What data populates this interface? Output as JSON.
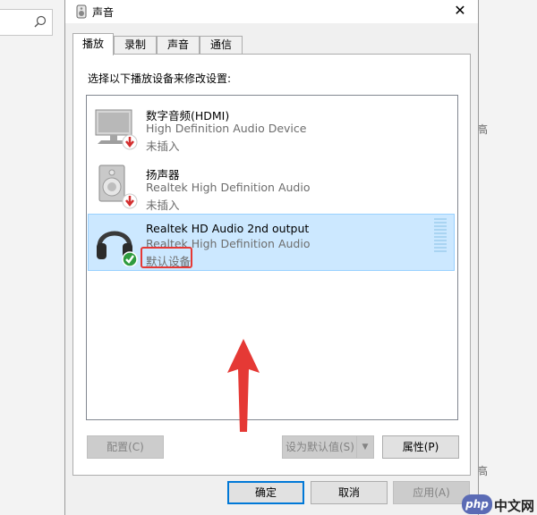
{
  "background": {
    "right_fragments": [
      "高",
      "高"
    ]
  },
  "dialog": {
    "title": "声音",
    "close_glyph": "✕",
    "tabs": [
      {
        "label": "播放",
        "active": true
      },
      {
        "label": "录制",
        "active": false
      },
      {
        "label": "声音",
        "active": false
      },
      {
        "label": "通信",
        "active": false
      }
    ],
    "instruction": "选择以下播放设备来修改设置:",
    "devices": [
      {
        "name": "数字音频(HDMI)",
        "description": "High Definition Audio Device",
        "status": "未插入",
        "icon": "monitor-icon",
        "badge": "red-down-arrow",
        "selected": false
      },
      {
        "name": "扬声器",
        "description": "Realtek High Definition Audio",
        "status": "未插入",
        "icon": "speaker-icon",
        "badge": "red-down-arrow",
        "selected": false
      },
      {
        "name": "Realtek HD Audio 2nd output",
        "description": "Realtek High Definition Audio",
        "status": "默认设备",
        "icon": "headphones-icon",
        "badge": "green-check",
        "selected": true
      }
    ],
    "buttons": {
      "configure": "配置(C)",
      "set_default": "设为默认值(S)",
      "properties": "属性(P)",
      "ok": "确定",
      "cancel": "取消",
      "apply": "应用(A)"
    }
  },
  "watermark": {
    "logo": "php",
    "text": "中文网"
  },
  "colors": {
    "selection": "#cce8ff",
    "annotation": "#e53935",
    "accent": "#0078d7"
  }
}
